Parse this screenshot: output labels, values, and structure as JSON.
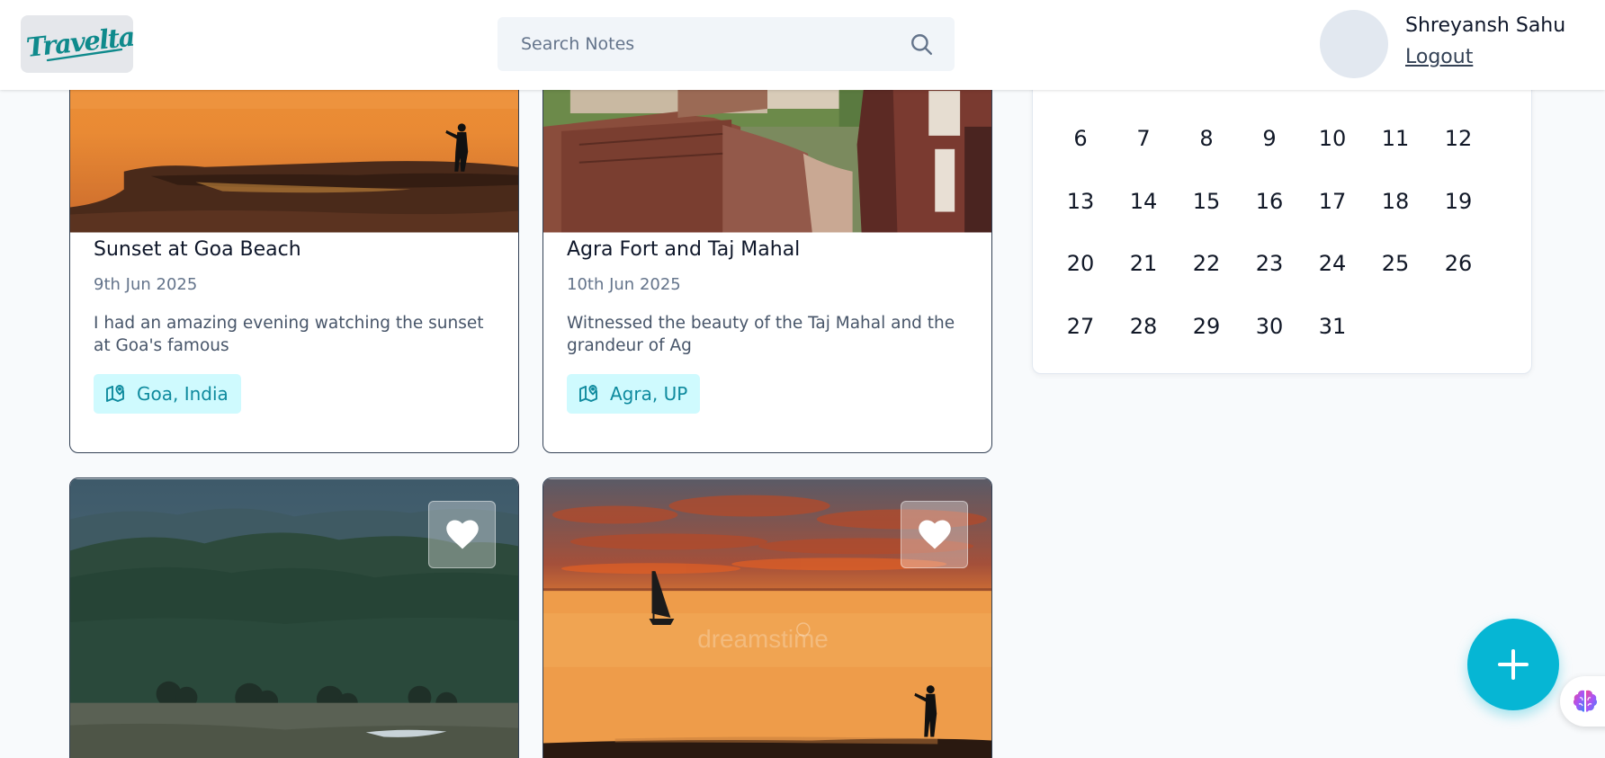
{
  "navbar": {
    "logo_text": "Traveltale",
    "search": {
      "placeholder": "Search Notes",
      "value": ""
    },
    "user": {
      "name": "Shreyansh Sahu",
      "logout_label": "Logout"
    }
  },
  "cards": [
    {
      "title": "Sunset at Goa Beach",
      "date": "9th Jun 2025",
      "description": "I had an amazing evening watching the sunset at Goa's famous",
      "location": "Goa, India"
    },
    {
      "title": "Agra Fort and Taj Mahal",
      "date": "10th Jun 2025",
      "description": "Witnessed the beauty of the Taj Mahal and the grandeur of Ag",
      "location": "Agra, UP"
    },
    {
      "favorite": true
    },
    {
      "favorite": true,
      "watermark": "dreamstime"
    }
  ],
  "calendar": {
    "days": [
      "6",
      "7",
      "8",
      "9",
      "10",
      "11",
      "12",
      "13",
      "14",
      "15",
      "16",
      "17",
      "18",
      "19",
      "20",
      "21",
      "22",
      "23",
      "24",
      "25",
      "26",
      "27",
      "28",
      "29",
      "30",
      "31"
    ]
  },
  "icons": {
    "search": "search-icon",
    "location": "map-pin-icon",
    "favorite": "heart-icon",
    "add": "plus-icon",
    "extension": "brain-icon"
  },
  "colors": {
    "accent": "#06b6d4",
    "chip_bg": "#cffafe",
    "chip_text": "#0e8a9e"
  }
}
